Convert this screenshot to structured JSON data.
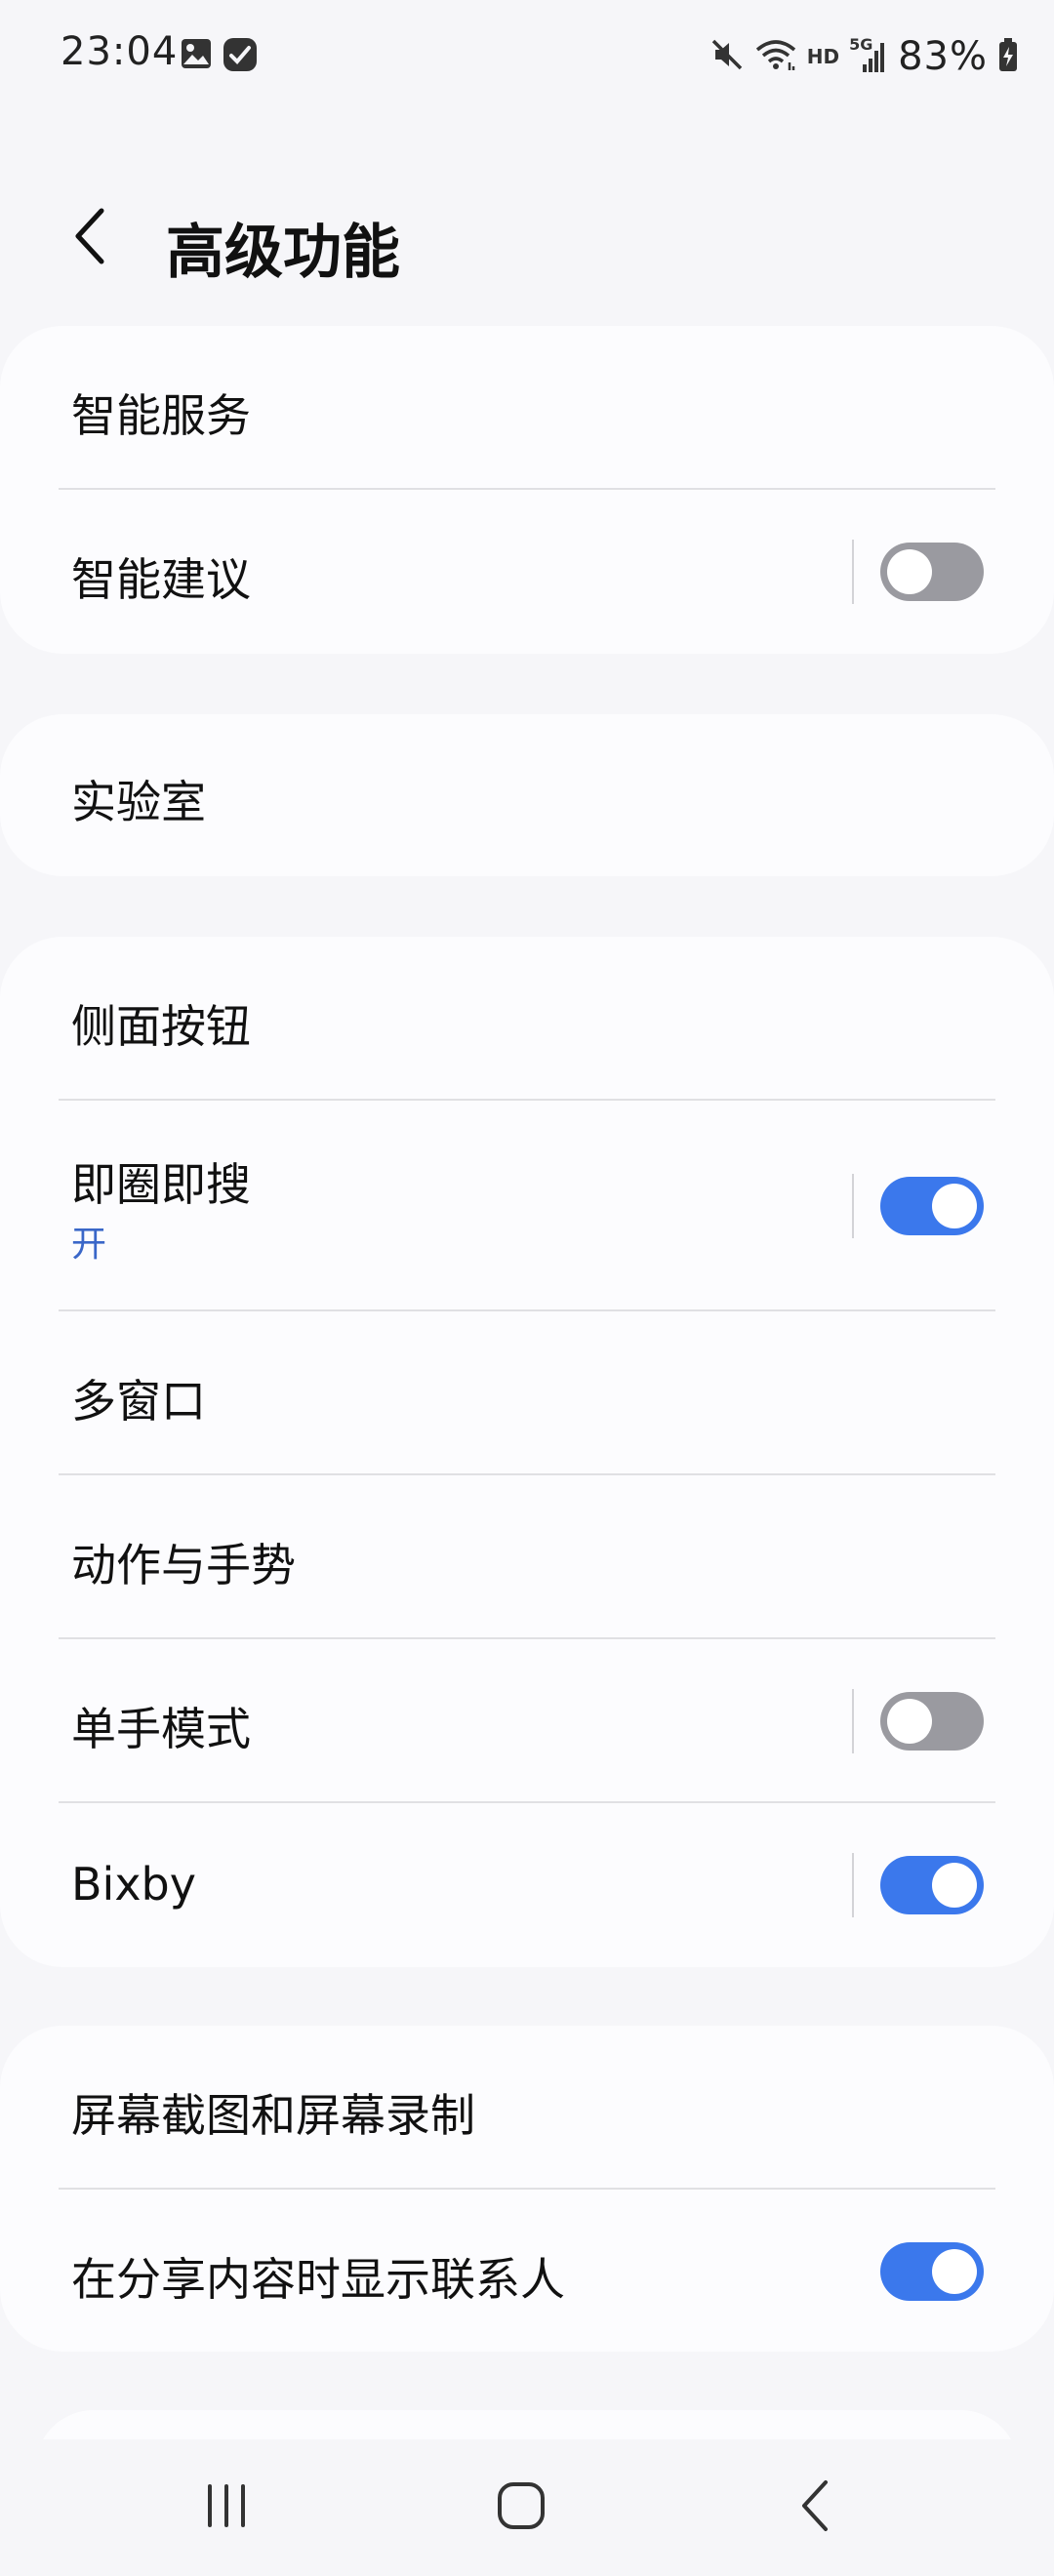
{
  "status_bar": {
    "time": "23:04",
    "battery": "83%",
    "icons": [
      "image-icon",
      "check-app-icon",
      "mute-icon",
      "wifi-icon",
      "hd-icon",
      "5g-signal-icon",
      "battery-charging-icon"
    ],
    "network_hd": "HD",
    "network_5g": "5G"
  },
  "header": {
    "title": "高级功能",
    "back_icon": "chevron-left-icon"
  },
  "cards": [
    {
      "rows": [
        {
          "label": "智能服务"
        },
        {
          "label": "智能建议",
          "toggle": false
        }
      ]
    },
    {
      "rows": [
        {
          "label": "实验室"
        }
      ]
    },
    {
      "rows": [
        {
          "label": "侧面按钮"
        },
        {
          "label": "即圈即搜",
          "sub": "开",
          "toggle": true
        },
        {
          "label": "多窗口"
        },
        {
          "label": "动作与手势"
        },
        {
          "label": "单手模式",
          "toggle": false
        },
        {
          "label": "Bixby",
          "toggle": true
        }
      ]
    },
    {
      "rows": [
        {
          "label": "屏幕截图和屏幕录制"
        },
        {
          "label": "在分享内容时显示联系人",
          "toggle": true
        }
      ]
    }
  ],
  "nav_bar": {
    "icons": [
      "recent-apps-icon",
      "home-icon",
      "back-icon"
    ]
  },
  "colors": {
    "accent": "#3b78ec",
    "toggle_off": "#9a9aa0",
    "sub_text": "#3a67c8",
    "background": "#f6f6f9",
    "card": "#fcfcfe"
  }
}
